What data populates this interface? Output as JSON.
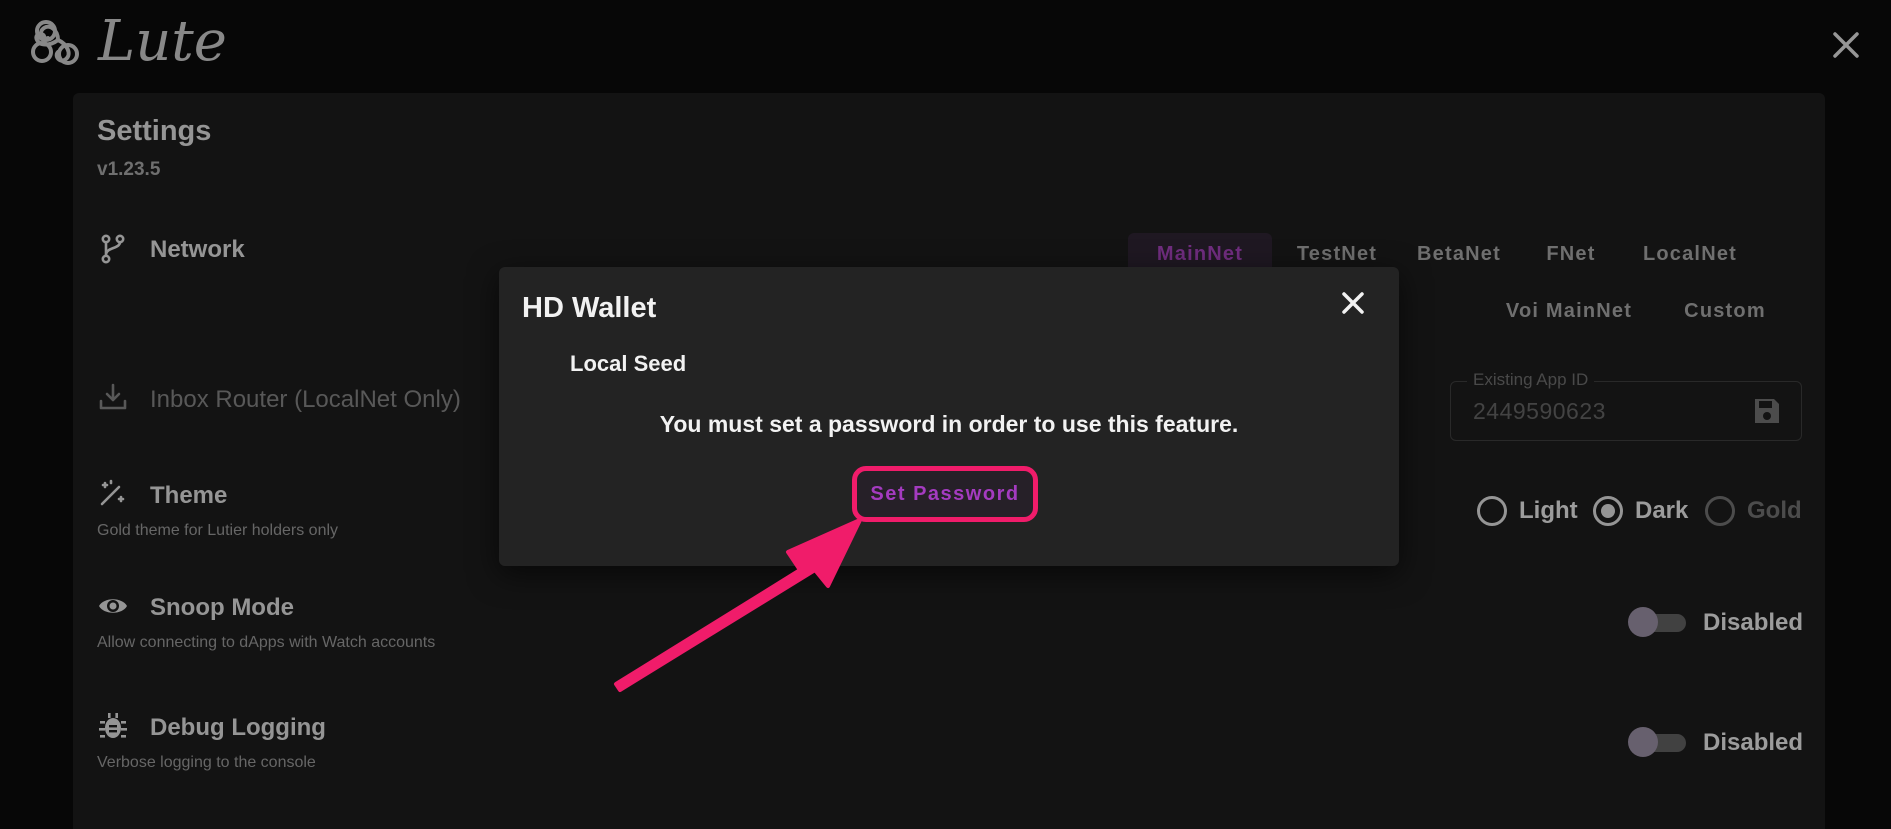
{
  "app": {
    "name": "Lute"
  },
  "settings": {
    "title": "Settings",
    "version": "v1.23.5",
    "network": {
      "label": "Network",
      "tabs": [
        {
          "label": "MainNet",
          "active": true
        },
        {
          "label": "TestNet",
          "active": false
        },
        {
          "label": "BetaNet",
          "active": false
        },
        {
          "label": "FNet",
          "active": false
        },
        {
          "label": "LocalNet",
          "active": false
        },
        {
          "label": "Voi MainNet",
          "active": false
        },
        {
          "label": "Custom",
          "active": false
        }
      ]
    },
    "inbox_router": {
      "label": "Inbox Router (LocalNet Only)",
      "field_label": "Existing App ID",
      "field_value": "2449590623"
    },
    "theme": {
      "label": "Theme",
      "description": "Gold theme for Lutier holders only",
      "options": [
        {
          "label": "Light",
          "checked": false,
          "disabled": false
        },
        {
          "label": "Dark",
          "checked": true,
          "disabled": false
        },
        {
          "label": "Gold",
          "checked": false,
          "disabled": true
        }
      ]
    },
    "snoop_mode": {
      "label": "Snoop Mode",
      "description": "Allow connecting to dApps with Watch accounts",
      "status": "Disabled"
    },
    "debug_logging": {
      "label": "Debug Logging",
      "description": "Verbose logging to the console",
      "status": "Disabled"
    }
  },
  "dialog": {
    "title": "HD Wallet",
    "subtitle": "Local Seed",
    "message": "You must set a password in order to use this feature.",
    "button_label": "Set Password"
  },
  "colors": {
    "accent": "#9b3fb0",
    "annotation": "#f01c6a",
    "background": "#0b0b0b",
    "panel": "#1b1b1b",
    "dialog": "#232323"
  }
}
